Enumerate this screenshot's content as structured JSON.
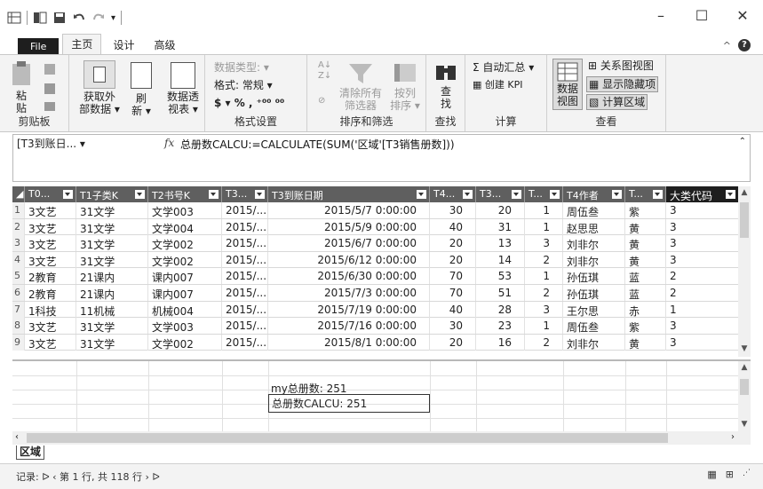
{
  "tabs": {
    "file": "File",
    "home": "主页",
    "design": "设计",
    "advanced": "高级"
  },
  "ribbon": {
    "clipboard": {
      "paste": "粘贴",
      "label": "剪贴板"
    },
    "external": {
      "label": "获取外部数据",
      "line1": "获取外",
      "line2": "部数据 ▾"
    },
    "refresh": {
      "line1": "刷",
      "line2": "新 ▾"
    },
    "pivot": {
      "line1": "数据透",
      "line2": "视表 ▾"
    },
    "format": {
      "datatype": "数据类型: ▾",
      "format": "格式: 常规 ▾",
      "currency": "$ ▾ %  ,  ⁺⁰⁰  ⁰⁰",
      "label": "格式设置"
    },
    "sortfilter": {
      "clear_line1": "清除所有",
      "clear_line2": "筛选器",
      "sort_line1": "按列",
      "sort_line2": "排序 ▾",
      "label": "排序和筛选"
    },
    "find": {
      "line1": "查",
      "line2": "找",
      "label": "查找"
    },
    "calc": {
      "autosum": "Σ 自动汇总 ▾",
      "kpi": "创建 KPI",
      "label": "计算"
    },
    "view": {
      "dataview_line1": "数据",
      "dataview_line2": "视图",
      "diagram": "关系图视图",
      "hidden": "显示隐藏项",
      "calcarea": "计算区域",
      "label": "查看"
    }
  },
  "formula_bar": {
    "name_box": "[T3到账日... ▾",
    "fx": "fx",
    "formula": "总册数CALCU:=CALCULATE(SUM('区域'[T3销售册数]))"
  },
  "columns": [
    "T0...",
    "T1子类K",
    "T2书号K",
    "T3...",
    "T3到账日期",
    "T4...",
    "T3...",
    "T...",
    "T4作者",
    "T...",
    "大类代码"
  ],
  "rows": [
    [
      "1",
      "3文艺",
      "31文学",
      "文学003",
      "2015/...",
      "2015/5/7 0:00:00",
      "30",
      "20",
      "1",
      "周伍叁",
      "紫",
      "3"
    ],
    [
      "2",
      "3文艺",
      "31文学",
      "文学004",
      "2015/...",
      "2015/5/9 0:00:00",
      "40",
      "31",
      "1",
      "赵思思",
      "黄",
      "3"
    ],
    [
      "3",
      "3文艺",
      "31文学",
      "文学002",
      "2015/...",
      "2015/6/7 0:00:00",
      "20",
      "13",
      "3",
      "刘非尔",
      "黄",
      "3"
    ],
    [
      "4",
      "3文艺",
      "31文学",
      "文学002",
      "2015/...",
      "2015/6/12 0:00:00",
      "20",
      "14",
      "2",
      "刘非尔",
      "黄",
      "3"
    ],
    [
      "5",
      "2教育",
      "21课内",
      "课内007",
      "2015/...",
      "2015/6/30 0:00:00",
      "70",
      "53",
      "1",
      "孙伍琪",
      "蓝",
      "2"
    ],
    [
      "6",
      "2教育",
      "21课内",
      "课内007",
      "2015/...",
      "2015/7/3 0:00:00",
      "70",
      "51",
      "2",
      "孙伍琪",
      "蓝",
      "2"
    ],
    [
      "7",
      "1科技",
      "11机械",
      "机械004",
      "2015/...",
      "2015/7/19 0:00:00",
      "40",
      "28",
      "3",
      "王尔思",
      "赤",
      "1"
    ],
    [
      "8",
      "3文艺",
      "31文学",
      "文学003",
      "2015/...",
      "2015/7/16 0:00:00",
      "30",
      "23",
      "1",
      "周伍叁",
      "紫",
      "3"
    ],
    [
      "9",
      "3文艺",
      "31文学",
      "文学002",
      "2015/...",
      "2015/8/1 0:00:00",
      "20",
      "16",
      "2",
      "刘非尔",
      "黄",
      "3"
    ]
  ],
  "measures": {
    "my_total": "my总册数: 251",
    "calcu_total": "总册数CALCU: 251"
  },
  "sheet_tab": "区域",
  "status": {
    "record": "记录:  ᐅ ‹  第 1 行, 共 118 行  ›  ᐅ"
  }
}
